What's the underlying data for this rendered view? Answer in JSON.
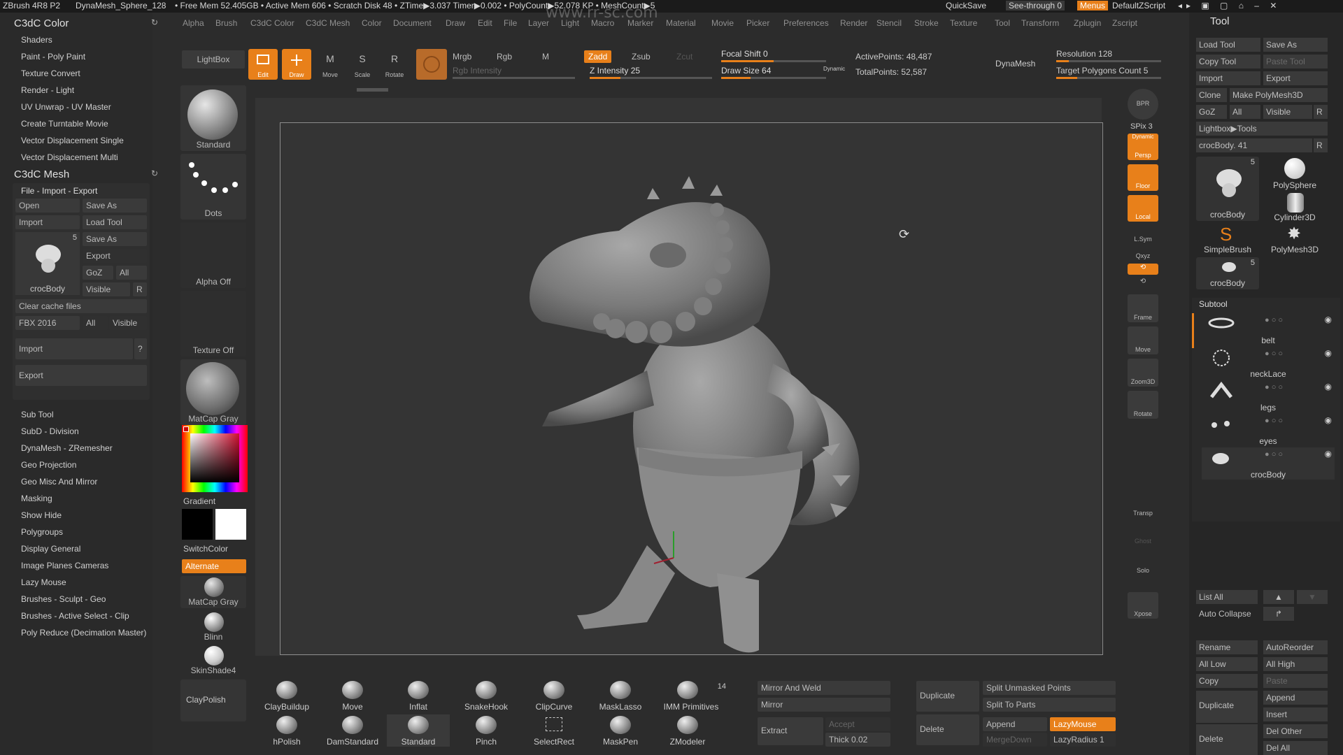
{
  "topbar": {
    "app": "ZBrush 4R8 P2",
    "doc": "DynaMesh_Sphere_128",
    "stats": "• Free Mem 52.405GB • Active Mem 606 • Scratch Disk 48 • ZTime▶3.037 Timer▶0.002 • PolyCount▶52.078 KP • MeshCount▶5",
    "watermark_url": "www.rr-sc.com",
    "quicksave": "QuickSave",
    "seethrough": "See-through  0",
    "menus": "Menus",
    "script": "DefaultZScript"
  },
  "menubar": [
    "Alpha",
    "Brush",
    "C3dC Color",
    "C3dC Mesh",
    "Color",
    "Document",
    "Draw",
    "Edit",
    "File",
    "Layer",
    "Light",
    "Macro",
    "Marker",
    "Material",
    "Movie",
    "Picker",
    "Preferences",
    "Render",
    "Stencil",
    "Stroke",
    "Texture",
    "Tool",
    "Transform",
    "Zplugin",
    "Zscript"
  ],
  "left": {
    "color_title": "C3dC Color",
    "color_items": [
      "Shaders",
      "Paint - Poly Paint",
      "Texture Convert",
      "Render - Light",
      "UV Unwrap - UV Master",
      "Create Turntable Movie",
      "Vector Displacement Single",
      "Vector Displacement Multi"
    ],
    "mesh_title": "C3dC Mesh",
    "file_title": "File - Import - Export",
    "open": "Open",
    "save_as": "Save As",
    "import": "Import",
    "load_tool": "Load Tool",
    "save_as2": "Save As",
    "export": "Export",
    "goz": "GoZ",
    "all": "All",
    "visible": "Visible",
    "r": "R",
    "thumb_count": "5",
    "thumb_name": "crocBody",
    "clear_cache": "Clear cache files",
    "fbx": "FBX 2016",
    "fbx_all": "All",
    "fbx_visible": "Visible",
    "import_big": "Import",
    "q": "?",
    "export_big": "Export",
    "mesh_items": [
      "Sub Tool",
      "SubD - Division",
      "DynaMesh - ZRemesher",
      "Geo Projection",
      "Geo Misc And Mirror",
      "Masking",
      "Show Hide",
      "Polygroups",
      "Display General",
      "Image Planes Cameras",
      "Lazy Mouse",
      "Brushes - Sculpt - Geo",
      "Brushes - Active Select - Clip",
      "Poly Reduce (Decimation Master)"
    ]
  },
  "shelf": {
    "lightbox": "LightBox",
    "standard": "Standard",
    "dots": "Dots",
    "alpha_off": "Alpha Off",
    "texture_off": "Texture Off",
    "matcap": "MatCap Gray",
    "gradient": "Gradient",
    "switchcolor": "SwitchColor",
    "alternate": "Alternate",
    "matcap2": "MatCap Gray",
    "blinn": "Blinn",
    "skinshade": "SkinShade4",
    "claypolish": "ClayPolish"
  },
  "toolbar": {
    "edit": "Edit",
    "draw": "Draw",
    "move": "Move",
    "scale": "Scale",
    "rotate": "Rotate",
    "mrgb": "Mrgb",
    "rgb": "Rgb",
    "m": "M",
    "rgb_intensity": "Rgb Intensity",
    "zadd": "Zadd",
    "zsub": "Zsub",
    "zcut": "Zcut",
    "z_intensity": "Z Intensity 25",
    "focal_shift": "Focal Shift 0",
    "draw_size": "Draw Size 64",
    "dynamic": "Dynamic",
    "active_points": "ActivePoints: 48,487",
    "total_points": "TotalPoints: 52,587",
    "dynamesh": "DynaMesh",
    "resolution": "Resolution 128",
    "target_poly": "Target Polygons Count 5"
  },
  "rightcol": {
    "bpr": "BPR",
    "spix": "SPix 3",
    "persp": "Persp",
    "floor": "Floor",
    "local": "Local",
    "lsym": "L.Sym",
    "xyz": "Qxyz",
    "frame": "Frame",
    "move": "Move",
    "zoom": "Zoom3D",
    "rotate": "Rotate",
    "transp": "Transp",
    "ghost": "Ghost",
    "solo": "Solo",
    "xpose": "Xpose",
    "dynamic": "Dynamic"
  },
  "tool": {
    "title": "Tool",
    "load_tool": "Load Tool",
    "save_as": "Save As",
    "copy_tool": "Copy Tool",
    "paste_tool": "Paste Tool",
    "import": "Import",
    "export": "Export",
    "clone": "Clone",
    "make_polymesh": "Make PolyMesh3D",
    "goz": "GoZ",
    "all": "All",
    "visible": "Visible",
    "r": "R",
    "lightbox_tools": "Lightbox▶Tools",
    "crocbody_slider": "crocBody. 41",
    "r2": "R",
    "thumbs": [
      {
        "name": "crocBody",
        "count": "5"
      },
      {
        "name": "PolySphere",
        "count": ""
      },
      {
        "name": "Cylinder3D",
        "count": ""
      },
      {
        "name": "SimpleBrush",
        "count": ""
      },
      {
        "name": "PolyMesh3D",
        "count": ""
      },
      {
        "name": "crocBody",
        "count": "5"
      }
    ],
    "subtool_title": "Subtool",
    "subtools": [
      "belt",
      "neckLace",
      "legs",
      "eyes",
      "crocBody"
    ],
    "list_all": "List All",
    "auto_collapse": "Auto Collapse",
    "rename": "Rename",
    "autoreorder": "AutoReorder",
    "all_low": "All Low",
    "all_high": "All High",
    "copy": "Copy",
    "paste": "Paste",
    "duplicate": "Duplicate",
    "append": "Append",
    "insert": "Insert",
    "delete": "Delete",
    "del_other": "Del Other",
    "del_all": "Del All"
  },
  "brushes": {
    "row1": [
      "ClayBuildup",
      "Move",
      "Inflat",
      "SnakeHook",
      "ClipCurve",
      "MaskLasso",
      "IMM Primitives"
    ],
    "row2": [
      "hPolish",
      "DamStandard",
      "Standard",
      "Pinch",
      "SelectRect",
      "MaskPen",
      "ZModeler"
    ],
    "imm_count": "14"
  },
  "bottom": {
    "mirror_weld": "Mirror And Weld",
    "mirror": "Mirror",
    "extract": "Extract",
    "accept": "Accept",
    "thick": "Thick 0.02",
    "duplicate": "Duplicate",
    "delete": "Delete",
    "split_unmasked": "Split Unmasked Points",
    "split_parts": "Split To Parts",
    "append": "Append",
    "mergedown": "MergeDown",
    "lazymouse": "LazyMouse",
    "lazyradius": "LazyRadius 1"
  },
  "colors": {
    "accent": "#e8801a",
    "bg": "#2c2c2c",
    "panel": "#262626"
  }
}
